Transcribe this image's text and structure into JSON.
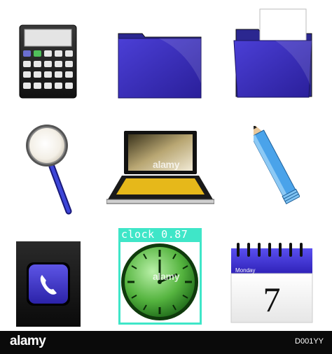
{
  "detection": {
    "label": "clock 0.87",
    "color": "#3fe6c8"
  },
  "calendar": {
    "month": "Monday",
    "day": "7"
  },
  "watermark": {
    "brand": "alamy",
    "image_id": "D001YY"
  },
  "icons": [
    "calculator-icon",
    "folder-icon",
    "open-folder-icon",
    "magnifier-icon",
    "laptop-icon",
    "pencil-icon",
    "phone-app-icon",
    "clock-icon",
    "calendar-icon"
  ]
}
